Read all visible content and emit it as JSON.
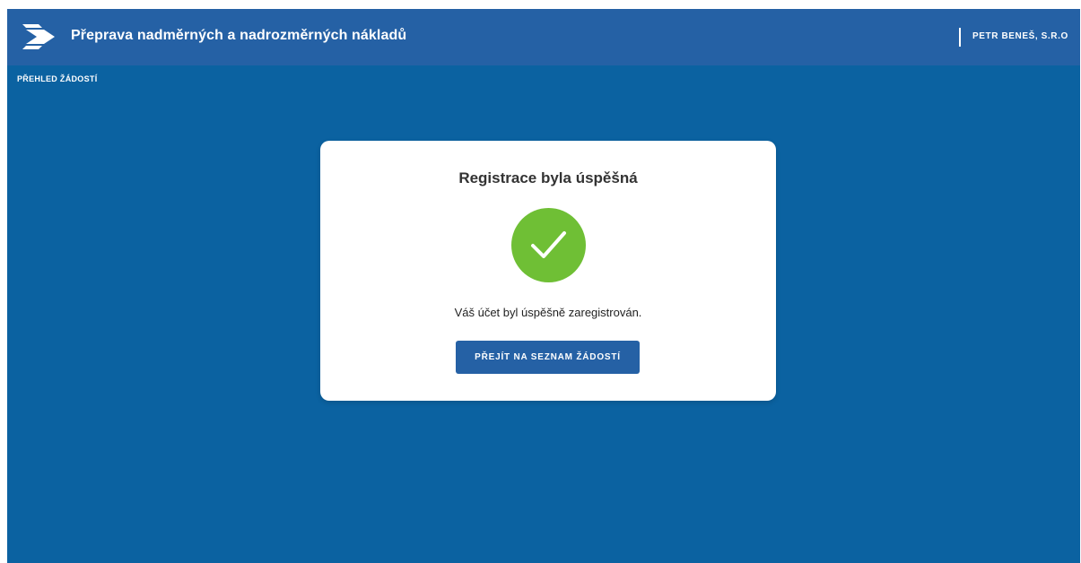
{
  "header": {
    "title": "Přeprava nadměrných a nadrozměrných nákladů",
    "company": "PETR BENEŠ, S.R.O",
    "logo_icon": "arrow-logo-icon"
  },
  "nav": {
    "overview_link": "PŘEHLED ŽÁDOSTÍ"
  },
  "card": {
    "title": "Registrace byla úspěšná",
    "status_icon": "check-circle-icon",
    "message": "Váš účet byl úspěšně zaregistrován.",
    "button_label": "PŘEJÍT NA SEZNAM ŽÁDOSTÍ"
  },
  "colors": {
    "header_bg": "#2561a5",
    "page_bg": "#0b62a1",
    "success_green": "#6fbf35",
    "button_bg": "#2561a5"
  }
}
